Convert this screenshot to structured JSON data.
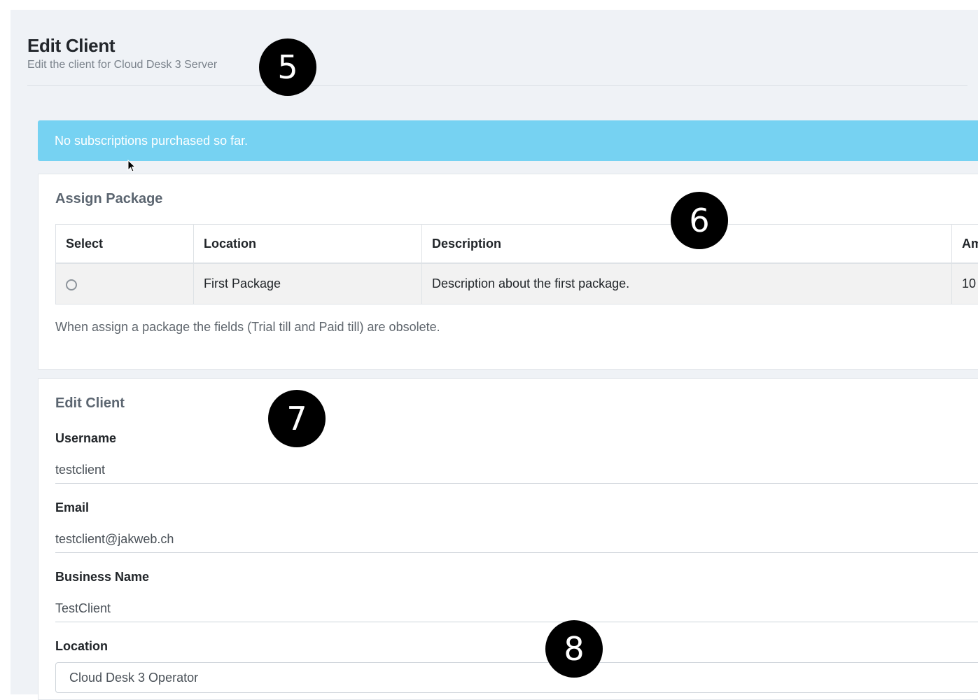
{
  "header": {
    "title": "Edit Client",
    "subtitle": "Edit the client for Cloud Desk 3 Server"
  },
  "alert": {
    "text": "No subscriptions purchased so far."
  },
  "assign_package": {
    "title": "Assign Package",
    "columns": [
      "Select",
      "Location",
      "Description",
      "Am"
    ],
    "rows": [
      {
        "location": "First Package",
        "description": "Description about the first package.",
        "amount": "10"
      }
    ],
    "help_text": "When assign a package the fields (Trial till and Paid till) are obsolete."
  },
  "edit_client": {
    "title": "Edit Client",
    "username_label": "Username",
    "username_value": "testclient",
    "email_label": "Email",
    "email_value": "testclient@jakweb.ch",
    "business_label": "Business Name",
    "business_value": "TestClient",
    "location_label": "Location",
    "location_value": "Cloud Desk 3 Operator"
  },
  "callouts": [
    "5",
    "6",
    "7",
    "8"
  ],
  "colors": {
    "alert_bg": "#76d2f2",
    "page_bg": "#eff2f6",
    "callout_bg": "#000000"
  }
}
